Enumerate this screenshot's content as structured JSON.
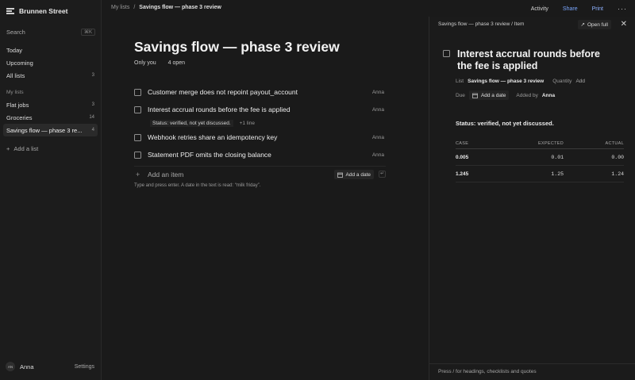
{
  "sidebar": {
    "brand": "Brunnen Street",
    "search": {
      "label": "Search",
      "shortcut": "⌘K"
    },
    "nav": [
      {
        "label": "Today",
        "count": ""
      },
      {
        "label": "Upcoming",
        "count": ""
      },
      {
        "label": "All lists",
        "count": "3"
      }
    ],
    "section_heading": "My lists",
    "lists": [
      {
        "label": "Flat jobs",
        "count": "3"
      },
      {
        "label": "Groceries",
        "count": "14"
      },
      {
        "label": "Savings flow — phase 3 re...",
        "count": "4",
        "active": true
      }
    ],
    "add_list": "Add a list",
    "user": {
      "initials": "AN",
      "name": "Anna"
    },
    "settings": "Settings"
  },
  "topbar": {
    "crumb_root": "My lists",
    "crumb_sep": "/",
    "crumb_current": "Savings flow — phase 3 review",
    "activity": "Activity",
    "share": "Share",
    "print": "Print",
    "more": "···"
  },
  "main": {
    "title": "Savings flow — phase 3 review",
    "filter": "Only you",
    "open_count": "4 open",
    "tasks": [
      {
        "title": "Customer merge does not repoint payout_account",
        "assignee": "Anna"
      },
      {
        "title": "Interest accrual rounds before the fee is applied",
        "assignee": "Anna",
        "note": "Status: verified, not yet discussed.",
        "more": "+1 line"
      },
      {
        "title": "Webhook retries share an idempotency key",
        "assignee": "Anna"
      },
      {
        "title": "Statement PDF omits the closing balance",
        "assignee": "Anna"
      }
    ],
    "add_item": "Add an item",
    "add_date": "Add a date",
    "enter_glyph": "↵",
    "hint": "Type and press enter. A date in the text is read: “milk friday”."
  },
  "panel": {
    "crumb": "Savings flow — phase 3 review / Item",
    "open_full": "Open full",
    "close": "✕",
    "title": "Interest accrual rounds before the fee is applied",
    "list_label": "List",
    "list_value": "Savings flow — phase 3 review",
    "quantity_label": "Quantity",
    "quantity_value": "Add",
    "due_label": "Due",
    "due_value": "Add a date",
    "added_by_label": "Added by",
    "added_by_value": "Anna",
    "status": "Status: verified, not yet discussed.",
    "table": {
      "headers": [
        "CASE",
        "EXPECTED",
        "ACTUAL"
      ],
      "rows": [
        [
          "0.005",
          "0.01",
          "0.00"
        ],
        [
          "1.245",
          "1.25",
          "1.24"
        ]
      ]
    },
    "footer": "Press / for headings, checklists and quotes"
  }
}
